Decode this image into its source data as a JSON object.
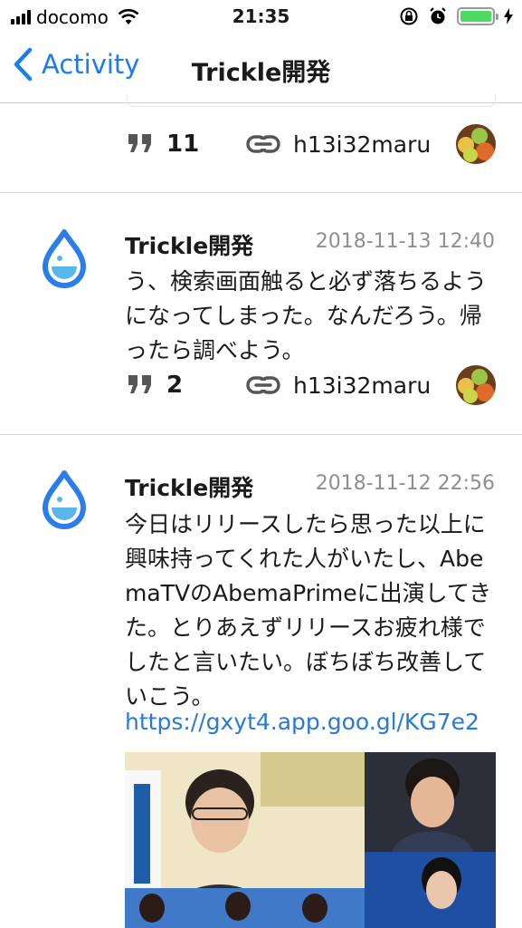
{
  "status_bar": {
    "carrier": "docomo",
    "time": "21:35"
  },
  "nav": {
    "back_label": "Activity",
    "title": "Trickle開発"
  },
  "top_post_partial": {
    "reply_count": "11",
    "username": "h13i32maru"
  },
  "posts": [
    {
      "author": "Trickle開発",
      "date": "2018-11-13 12:40",
      "body": "う、検索画面触ると必ず落ちるようになってしまった。なんだろう。帰ったら調べよう。",
      "reply_count": "2",
      "username": "h13i32maru"
    },
    {
      "author": "Trickle開発",
      "date": "2018-11-12 22:56",
      "body": "今日はリリースしたら思った以上に興味持ってくれた人がいたし、AbemaTVのAbemaPrimeに出演してきた。とりあえずリリースお疲れ様でしたと言いたい。ぼちぼち改善していこう。",
      "link": "https://gxyt4.app.goo.gl/KG7e2"
    }
  ],
  "colors": {
    "accent": "#1a7cf0",
    "link": "#2a7ad1",
    "drop_logo": "#2b7de9",
    "battery": "#4cd964"
  }
}
